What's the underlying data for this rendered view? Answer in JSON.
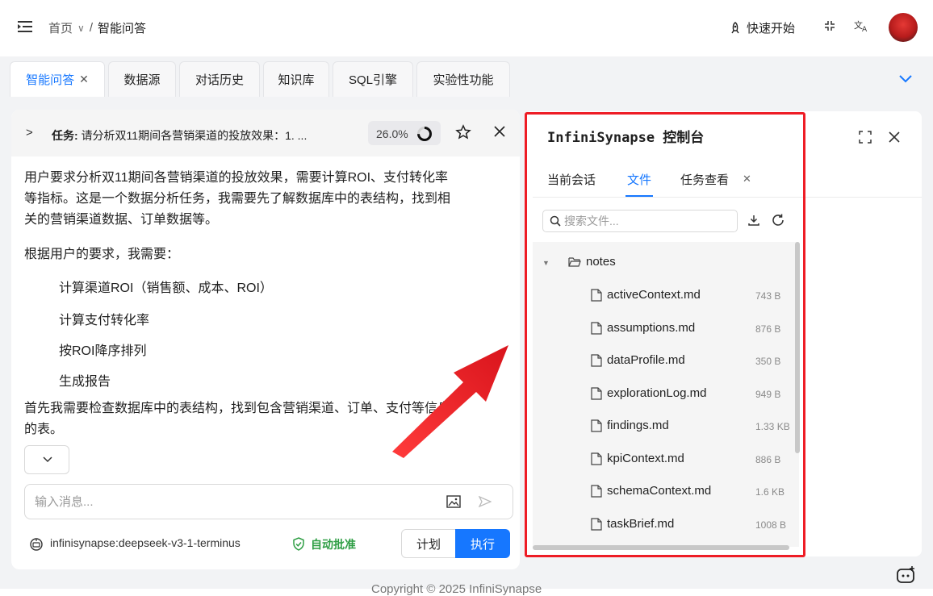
{
  "header": {
    "breadcrumb_home": "首页",
    "breadcrumb_sep": "/",
    "breadcrumb_current": "智能问答",
    "quick_start": "快速开始"
  },
  "tabs": [
    {
      "label": "智能问答",
      "active": true,
      "closable": true
    },
    {
      "label": "数据源"
    },
    {
      "label": "对话历史"
    },
    {
      "label": "知识库"
    },
    {
      "label": "SQL引擎"
    },
    {
      "label": "实验性功能"
    }
  ],
  "chat": {
    "task_label": "任务:",
    "task_text": "请分析双11期间各营销渠道的投放效果：1. ...",
    "progress": "26.0%",
    "progress_value": 0.26,
    "paragraph1_line1": "用户要求分析双11期间各营销渠道的投放效果，需要计算ROI、支付转化率",
    "paragraph1_line2": "等指标。这是一个数据分析任务，我需要先了解数据库中的表结构，找到相",
    "paragraph1_line3": "关的营销渠道数据、订单数据等。",
    "paragraph2": "根据用户的要求，我需要：",
    "list": [
      "计算渠道ROI（销售额、成本、ROI）",
      "计算支付转化率",
      "按ROI降序排列",
      "生成报告"
    ],
    "paragraph3_line1": "首先我需要检查数据库中的表结构，找到包含营销渠道、订单、支付等信息",
    "paragraph3_line2": "的表。",
    "input_placeholder": "输入消息...",
    "model_name": "infinisynapse:deepseek-v3-1-terminus",
    "auto_approve": "自动批准",
    "plan_label": "计划",
    "execute_label": "执行"
  },
  "console": {
    "title": "InfiniSynapse 控制台",
    "tabs": [
      "当前会话",
      "文件",
      "任务查看"
    ],
    "active_tab": "文件",
    "search_placeholder": "搜索文件...",
    "folder": "notes",
    "files": [
      {
        "name": "activeContext.md",
        "size": "743 B"
      },
      {
        "name": "assumptions.md",
        "size": "876 B"
      },
      {
        "name": "dataProfile.md",
        "size": "350 B"
      },
      {
        "name": "explorationLog.md",
        "size": "949 B"
      },
      {
        "name": "findings.md",
        "size": "1.33 KB"
      },
      {
        "name": "kpiContext.md",
        "size": "886 B"
      },
      {
        "name": "schemaContext.md",
        "size": "1.6 KB"
      },
      {
        "name": "taskBrief.md",
        "size": "1008 B"
      }
    ]
  },
  "footer": {
    "copyright": "Copyright © 2025 InfiniSynapse"
  },
  "colors": {
    "accent": "#1677ff",
    "approve": "#2e9e44",
    "highlight": "#ee1c25"
  }
}
